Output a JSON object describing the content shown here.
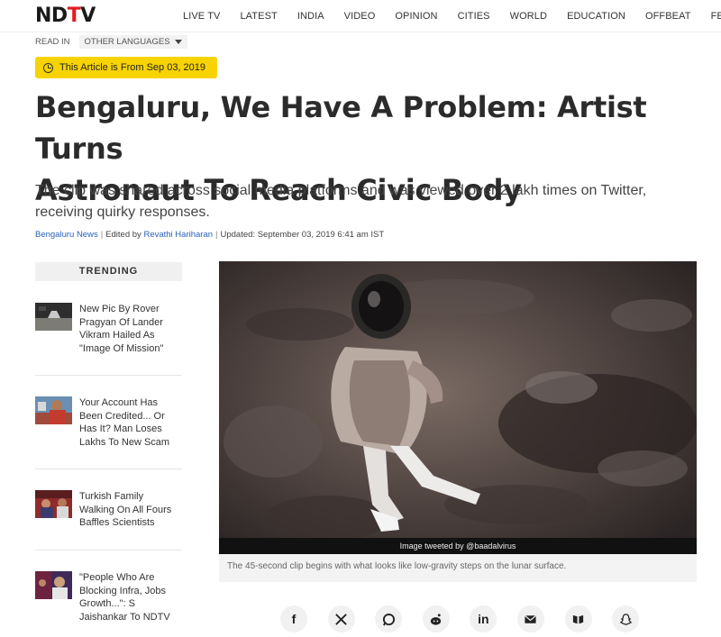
{
  "header": {
    "logo_nd": "ND",
    "logo_accent": "T",
    "logo_v": "V",
    "nav": [
      "LIVE TV",
      "LATEST",
      "INDIA",
      "VIDEO",
      "OPINION",
      "CITIES",
      "WORLD",
      "EDUCATION",
      "OFFBEAT",
      "FEATURE"
    ]
  },
  "read_in": {
    "label": "READ IN",
    "language_button": "OTHER LANGUAGES"
  },
  "badge": "This Article is From Sep 03, 2019",
  "article": {
    "headline_line1": "Bengaluru, We Have A Problem: Artist Turns",
    "headline_line2": "Astronaut To Reach Civic Body",
    "summary": "The clip was shared across social media platforms and was viewed over 2 lakh times on Twitter, receiving quirky responses.",
    "byline": {
      "category": "Bengaluru News",
      "edited_prefix": "Edited by",
      "editor": "Revathi Hariharan",
      "updated": "Updated: September 03, 2019 6:41 am IST"
    }
  },
  "trending": {
    "title": "TRENDING",
    "items": [
      {
        "title": "New Pic By Rover Pragyan Of Lander Vikram Hailed As \"Image Of Mission\""
      },
      {
        "title": "Your Account Has Been Credited... Or Has It? Man Loses Lakhs To New Scam"
      },
      {
        "title": "Turkish Family Walking On All Fours Baffles Scientists"
      },
      {
        "title": "\"People Who Are Blocking Infra, Jobs Growth...\": S Jaishankar To NDTV"
      }
    ]
  },
  "media": {
    "credit": "Image tweeted by @baadalvirus",
    "caption": "The 45-second clip begins with what looks like low-gravity steps on the lunar surface."
  },
  "share": {
    "icons": [
      "facebook-icon",
      "x-icon",
      "whatsapp-icon",
      "reddit-icon",
      "linkedin-icon",
      "email-icon",
      "koo-icon",
      "snapchat-icon"
    ],
    "glyphs": {
      "facebook": "f",
      "linkedin": "in"
    }
  }
}
